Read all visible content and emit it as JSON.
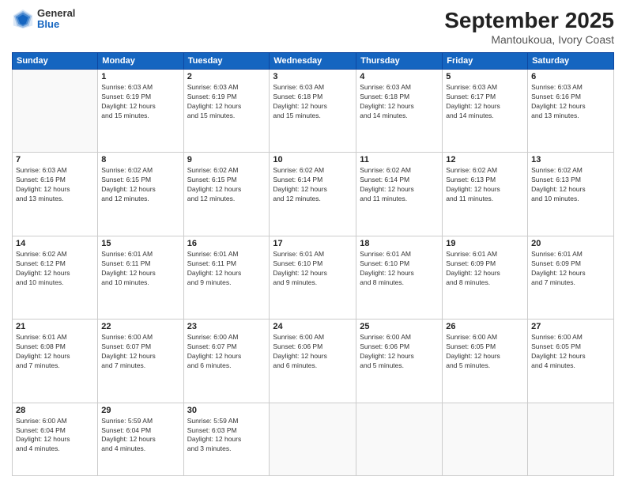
{
  "header": {
    "logo": {
      "general": "General",
      "blue": "Blue"
    },
    "title": "September 2025",
    "location": "Mantoukoua, Ivory Coast"
  },
  "calendar": {
    "days_of_week": [
      "Sunday",
      "Monday",
      "Tuesday",
      "Wednesday",
      "Thursday",
      "Friday",
      "Saturday"
    ],
    "weeks": [
      [
        {
          "day": "",
          "info": ""
        },
        {
          "day": "1",
          "info": "Sunrise: 6:03 AM\nSunset: 6:19 PM\nDaylight: 12 hours\nand 15 minutes."
        },
        {
          "day": "2",
          "info": "Sunrise: 6:03 AM\nSunset: 6:19 PM\nDaylight: 12 hours\nand 15 minutes."
        },
        {
          "day": "3",
          "info": "Sunrise: 6:03 AM\nSunset: 6:18 PM\nDaylight: 12 hours\nand 15 minutes."
        },
        {
          "day": "4",
          "info": "Sunrise: 6:03 AM\nSunset: 6:18 PM\nDaylight: 12 hours\nand 14 minutes."
        },
        {
          "day": "5",
          "info": "Sunrise: 6:03 AM\nSunset: 6:17 PM\nDaylight: 12 hours\nand 14 minutes."
        },
        {
          "day": "6",
          "info": "Sunrise: 6:03 AM\nSunset: 6:16 PM\nDaylight: 12 hours\nand 13 minutes."
        }
      ],
      [
        {
          "day": "7",
          "info": "Sunrise: 6:03 AM\nSunset: 6:16 PM\nDaylight: 12 hours\nand 13 minutes."
        },
        {
          "day": "8",
          "info": "Sunrise: 6:02 AM\nSunset: 6:15 PM\nDaylight: 12 hours\nand 12 minutes."
        },
        {
          "day": "9",
          "info": "Sunrise: 6:02 AM\nSunset: 6:15 PM\nDaylight: 12 hours\nand 12 minutes."
        },
        {
          "day": "10",
          "info": "Sunrise: 6:02 AM\nSunset: 6:14 PM\nDaylight: 12 hours\nand 12 minutes."
        },
        {
          "day": "11",
          "info": "Sunrise: 6:02 AM\nSunset: 6:14 PM\nDaylight: 12 hours\nand 11 minutes."
        },
        {
          "day": "12",
          "info": "Sunrise: 6:02 AM\nSunset: 6:13 PM\nDaylight: 12 hours\nand 11 minutes."
        },
        {
          "day": "13",
          "info": "Sunrise: 6:02 AM\nSunset: 6:13 PM\nDaylight: 12 hours\nand 10 minutes."
        }
      ],
      [
        {
          "day": "14",
          "info": "Sunrise: 6:02 AM\nSunset: 6:12 PM\nDaylight: 12 hours\nand 10 minutes."
        },
        {
          "day": "15",
          "info": "Sunrise: 6:01 AM\nSunset: 6:11 PM\nDaylight: 12 hours\nand 10 minutes."
        },
        {
          "day": "16",
          "info": "Sunrise: 6:01 AM\nSunset: 6:11 PM\nDaylight: 12 hours\nand 9 minutes."
        },
        {
          "day": "17",
          "info": "Sunrise: 6:01 AM\nSunset: 6:10 PM\nDaylight: 12 hours\nand 9 minutes."
        },
        {
          "day": "18",
          "info": "Sunrise: 6:01 AM\nSunset: 6:10 PM\nDaylight: 12 hours\nand 8 minutes."
        },
        {
          "day": "19",
          "info": "Sunrise: 6:01 AM\nSunset: 6:09 PM\nDaylight: 12 hours\nand 8 minutes."
        },
        {
          "day": "20",
          "info": "Sunrise: 6:01 AM\nSunset: 6:09 PM\nDaylight: 12 hours\nand 7 minutes."
        }
      ],
      [
        {
          "day": "21",
          "info": "Sunrise: 6:01 AM\nSunset: 6:08 PM\nDaylight: 12 hours\nand 7 minutes."
        },
        {
          "day": "22",
          "info": "Sunrise: 6:00 AM\nSunset: 6:07 PM\nDaylight: 12 hours\nand 7 minutes."
        },
        {
          "day": "23",
          "info": "Sunrise: 6:00 AM\nSunset: 6:07 PM\nDaylight: 12 hours\nand 6 minutes."
        },
        {
          "day": "24",
          "info": "Sunrise: 6:00 AM\nSunset: 6:06 PM\nDaylight: 12 hours\nand 6 minutes."
        },
        {
          "day": "25",
          "info": "Sunrise: 6:00 AM\nSunset: 6:06 PM\nDaylight: 12 hours\nand 5 minutes."
        },
        {
          "day": "26",
          "info": "Sunrise: 6:00 AM\nSunset: 6:05 PM\nDaylight: 12 hours\nand 5 minutes."
        },
        {
          "day": "27",
          "info": "Sunrise: 6:00 AM\nSunset: 6:05 PM\nDaylight: 12 hours\nand 4 minutes."
        }
      ],
      [
        {
          "day": "28",
          "info": "Sunrise: 6:00 AM\nSunset: 6:04 PM\nDaylight: 12 hours\nand 4 minutes."
        },
        {
          "day": "29",
          "info": "Sunrise: 5:59 AM\nSunset: 6:04 PM\nDaylight: 12 hours\nand 4 minutes."
        },
        {
          "day": "30",
          "info": "Sunrise: 5:59 AM\nSunset: 6:03 PM\nDaylight: 12 hours\nand 3 minutes."
        },
        {
          "day": "",
          "info": ""
        },
        {
          "day": "",
          "info": ""
        },
        {
          "day": "",
          "info": ""
        },
        {
          "day": "",
          "info": ""
        }
      ]
    ]
  }
}
